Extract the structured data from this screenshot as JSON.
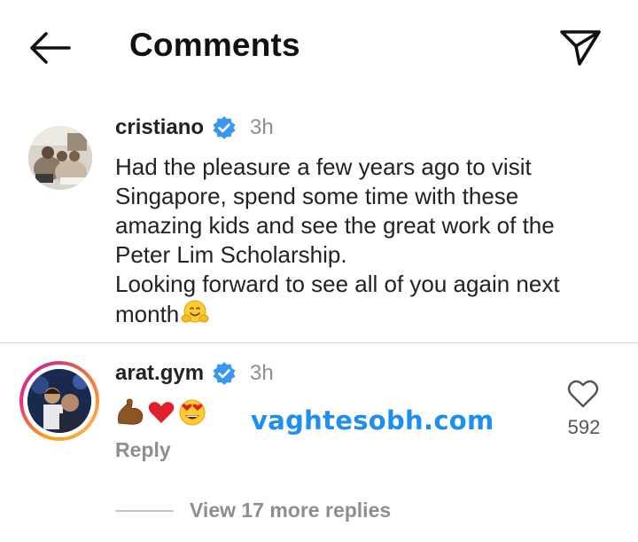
{
  "header": {
    "title": "Comments",
    "back_icon": "arrow-left-icon",
    "share_icon": "paper-plane-icon"
  },
  "caption": {
    "username": "cristiano",
    "verified": true,
    "time": "3h",
    "text": "Had the pleasure a few years ago to visit Singapore, spend some time with these amazing kids and see the great work of the Peter Lim Scholarship.\nLooking forward to see all of you again next month",
    "trailing_emoji": "hugging-face"
  },
  "comment": {
    "username": "arat.gym",
    "verified": true,
    "time": "3h",
    "emojis": [
      "flexed-biceps",
      "red-heart",
      "heart-eyes"
    ],
    "reply_label": "Reply",
    "like_count": "592",
    "view_replies_label": "View 17 more replies"
  },
  "watermark": "vaghtesobh.com",
  "colors": {
    "verified_blue": "#3897f0",
    "muted_gray": "#8e8e8e",
    "watermark_blue": "#1e8ff0",
    "text_dark": "#222222"
  }
}
